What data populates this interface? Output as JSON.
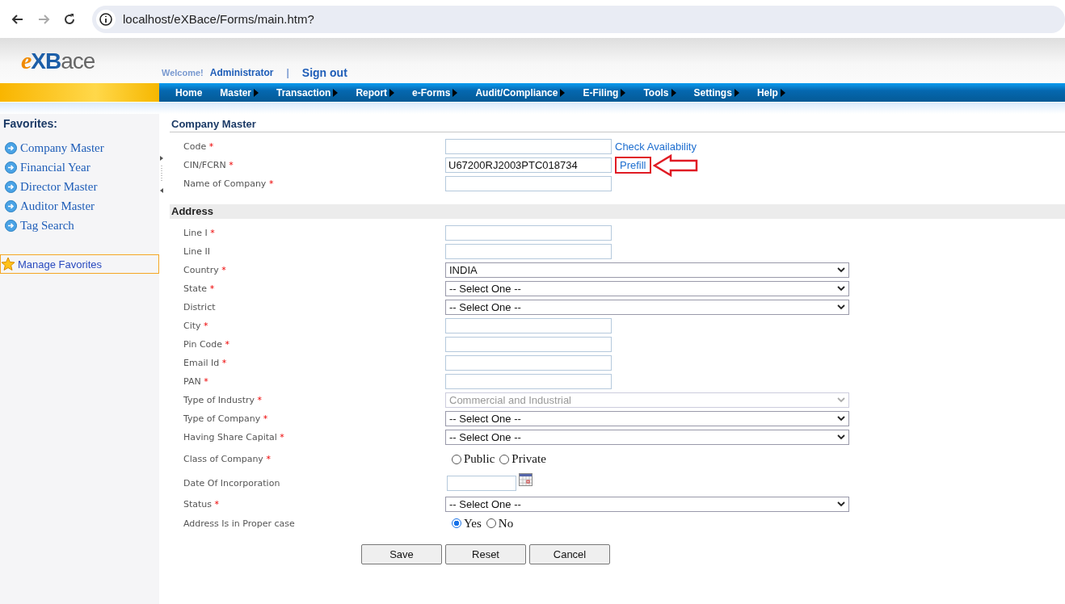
{
  "browser": {
    "url": "localhost/eXBace/Forms/main.htm?"
  },
  "header": {
    "logo_prefix": "e",
    "logo_main": "XB",
    "logo_suffix": "ace",
    "welcome": "Welcome!",
    "user": "Administrator",
    "separator": "|",
    "sign_out": "Sign out"
  },
  "menu": [
    {
      "label": "Home",
      "arrow": false
    },
    {
      "label": "Master",
      "arrow": true
    },
    {
      "label": "Transaction",
      "arrow": true
    },
    {
      "label": "Report",
      "arrow": true
    },
    {
      "label": "e-Forms",
      "arrow": true
    },
    {
      "label": "Audit/Compliance",
      "arrow": true
    },
    {
      "label": "E-Filing",
      "arrow": true
    },
    {
      "label": "Tools",
      "arrow": true
    },
    {
      "label": "Settings",
      "arrow": true
    },
    {
      "label": "Help",
      "arrow": true
    }
  ],
  "sidebar": {
    "title": "Favorites:",
    "items": [
      "Company Master",
      "Financial Year",
      "Director Master",
      "Auditor Master",
      "Tag Search"
    ],
    "manage": "Manage Favorites"
  },
  "sections": [
    {
      "title": "Company Master",
      "kind": "plain",
      "fields": [
        {
          "label": "Code",
          "required_mark": "*",
          "kind": "text",
          "link": "Check Availability",
          "highlighted": false
        },
        {
          "label": "CIN/FCRN",
          "required_mark": "*",
          "kind": "text",
          "value": "U67200RJ2003PTC018734",
          "link": "Prefill",
          "highlighted": true
        },
        {
          "label": "Name of Company",
          "required_mark": "*",
          "kind": "text"
        }
      ]
    },
    {
      "title": "Address",
      "kind": "shaded",
      "fields": [
        {
          "label": "Line I",
          "required_mark": "*",
          "kind": "text"
        },
        {
          "label": "Line II",
          "kind": "text"
        },
        {
          "label": "Country",
          "required_mark": "*",
          "kind": "select",
          "value": "INDIA",
          "disabled": false
        },
        {
          "label": "State",
          "required_mark": "*",
          "kind": "select",
          "value": "-- Select One --",
          "disabled": false
        },
        {
          "label": "District",
          "kind": "select",
          "value": "-- Select One --",
          "disabled": false
        },
        {
          "label": "City",
          "required_mark": "*",
          "kind": "text"
        },
        {
          "label": "Pin Code",
          "required_mark": "*",
          "kind": "text"
        },
        {
          "label": "Email Id",
          "required_mark": "*",
          "kind": "text"
        },
        {
          "label": "PAN",
          "required_mark": "*",
          "kind": "text"
        },
        {
          "label": "Type of Industry",
          "required_mark": "*",
          "kind": "select",
          "value": "Commercial and Industrial",
          "disabled": true
        },
        {
          "label": "Type of Company",
          "required_mark": "*",
          "kind": "select",
          "value": "-- Select One --",
          "disabled": false
        },
        {
          "label": "Having Share Capital",
          "required_mark": "*",
          "kind": "select",
          "value": "-- Select One --",
          "disabled": false
        },
        {
          "label": "Class of Company",
          "required_mark": "*",
          "kind": "radio",
          "options": [
            {
              "label": "Public",
              "selected": false
            },
            {
              "label": "Private",
              "selected": false
            }
          ]
        },
        {
          "label": "Date Of Incorporation",
          "kind": "date"
        },
        {
          "label": "Status",
          "required_mark": "*",
          "kind": "select",
          "value": "-- Select One --",
          "disabled": false
        },
        {
          "label": "Address Is in Proper case",
          "kind": "radio",
          "options": [
            {
              "label": "Yes",
              "selected": true
            },
            {
              "label": "No",
              "selected": false
            }
          ]
        }
      ]
    }
  ],
  "buttons": [
    "Save",
    "Reset",
    "Cancel"
  ]
}
